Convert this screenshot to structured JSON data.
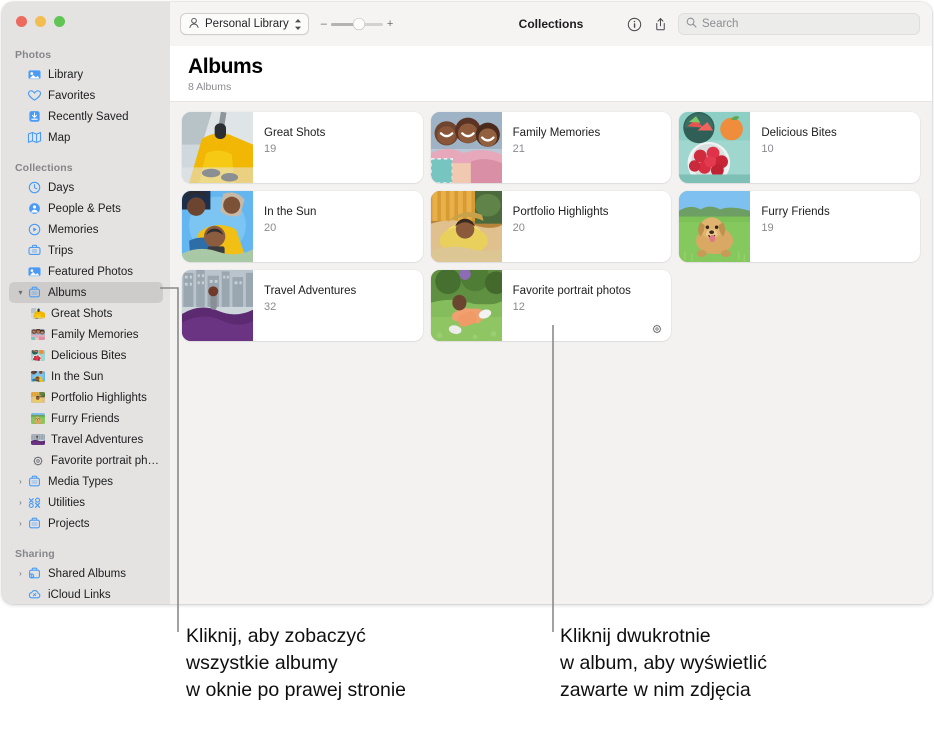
{
  "window": {
    "traffic_lights": [
      "close",
      "minimize",
      "zoom"
    ],
    "colors": {
      "close": "#ed6a5e",
      "minimize": "#f4bd50",
      "zoom": "#61c554",
      "accent": "#3d8bfd",
      "sidebar_bg": "#e4e3e2",
      "grid_bg": "#f3f2f1"
    }
  },
  "toolbar": {
    "library_label": "Personal Library",
    "library_icon": "person-icon",
    "chevron_icon": "chevron-up-down-icon",
    "zoom_out_label": "–",
    "zoom_in_label": "+",
    "title": "Collections",
    "info_icon": "info-circle-icon",
    "share_icon": "share-icon",
    "search_icon": "search-icon",
    "search_placeholder": "Search",
    "search_value": ""
  },
  "header": {
    "title": "Albums",
    "subtitle": "8 Albums"
  },
  "sidebar": {
    "groups": [
      {
        "label": "Photos",
        "items": [
          {
            "label": "Library",
            "icon": "photos-library-icon",
            "disclosure": "",
            "selected": false
          },
          {
            "label": "Favorites",
            "icon": "heart-icon",
            "disclosure": "",
            "selected": false
          },
          {
            "label": "Recently Saved",
            "icon": "tray-arrow-down-icon",
            "disclosure": "",
            "selected": false
          },
          {
            "label": "Map",
            "icon": "map-icon",
            "disclosure": "",
            "selected": false
          }
        ]
      },
      {
        "label": "Collections",
        "items": [
          {
            "label": "Days",
            "icon": "clock-icon",
            "disclosure": "",
            "selected": false
          },
          {
            "label": "People & Pets",
            "icon": "person-circle-icon",
            "disclosure": "",
            "selected": false
          },
          {
            "label": "Memories",
            "icon": "memories-play-icon",
            "disclosure": "",
            "selected": false
          },
          {
            "label": "Trips",
            "icon": "trips-suitcase-icon",
            "disclosure": "",
            "selected": false
          },
          {
            "label": "Featured Photos",
            "icon": "featured-photo-icon",
            "disclosure": "",
            "selected": false
          },
          {
            "label": "Albums",
            "icon": "album-folder-icon",
            "disclosure": "▾",
            "selected": true
          },
          {
            "label": "Great Shots",
            "icon": "album-thumb-great-shots",
            "child": true,
            "selected": false
          },
          {
            "label": "Family Memories",
            "icon": "album-thumb-family-memories",
            "child": true,
            "selected": false
          },
          {
            "label": "Delicious Bites",
            "icon": "album-thumb-delicious-bites",
            "child": true,
            "selected": false
          },
          {
            "label": "In the Sun",
            "icon": "album-thumb-in-the-sun",
            "child": true,
            "selected": false
          },
          {
            "label": "Portfolio Highlights",
            "icon": "album-thumb-portfolio-highlights",
            "child": true,
            "selected": false
          },
          {
            "label": "Furry Friends",
            "icon": "album-thumb-furry-friends",
            "child": true,
            "selected": false
          },
          {
            "label": "Travel Adventures",
            "icon": "album-thumb-travel-adventures",
            "child": true,
            "selected": false
          },
          {
            "label": "Favorite portrait photos",
            "icon": "smart-album-gear-icon",
            "child": true,
            "selected": false
          },
          {
            "label": "Media Types",
            "icon": "album-folder-icon",
            "disclosure": "›",
            "selected": false
          },
          {
            "label": "Utilities",
            "icon": "utilities-tools-icon",
            "disclosure": "›",
            "selected": false
          },
          {
            "label": "Projects",
            "icon": "album-folder-icon",
            "disclosure": "›",
            "selected": false
          }
        ]
      },
      {
        "label": "Sharing",
        "items": [
          {
            "label": "Shared Albums",
            "icon": "shared-album-icon",
            "disclosure": "›",
            "selected": false
          },
          {
            "label": "iCloud Links",
            "icon": "icloud-link-icon",
            "disclosure": "",
            "selected": false
          }
        ]
      }
    ]
  },
  "albums": [
    {
      "title": "Great Shots",
      "count": "19",
      "thumb": "thumb-great-shots",
      "smart": false
    },
    {
      "title": "Family Memories",
      "count": "21",
      "thumb": "thumb-family-memories",
      "smart": false
    },
    {
      "title": "Delicious Bites",
      "count": "10",
      "thumb": "thumb-delicious-bites",
      "smart": false
    },
    {
      "title": "In the Sun",
      "count": "20",
      "thumb": "thumb-in-the-sun",
      "smart": false
    },
    {
      "title": "Portfolio Highlights",
      "count": "20",
      "thumb": "thumb-portfolio-highlights",
      "smart": false
    },
    {
      "title": "Furry Friends",
      "count": "19",
      "thumb": "thumb-furry-friends",
      "smart": false
    },
    {
      "title": "Travel Adventures",
      "count": "32",
      "thumb": "thumb-travel-adventures",
      "smart": false
    },
    {
      "title": "Favorite portrait photos",
      "count": "12",
      "thumb": "thumb-favorite-portrait-photos",
      "smart": true
    }
  ],
  "callouts": {
    "left": "Kliknij, aby zobaczyć\nwszystkie albumy\nw oknie po prawej stronie",
    "right": "Kliknij dwukrotnie\nw album, aby wyświetlić\nzawarte w nim zdjęcia"
  }
}
